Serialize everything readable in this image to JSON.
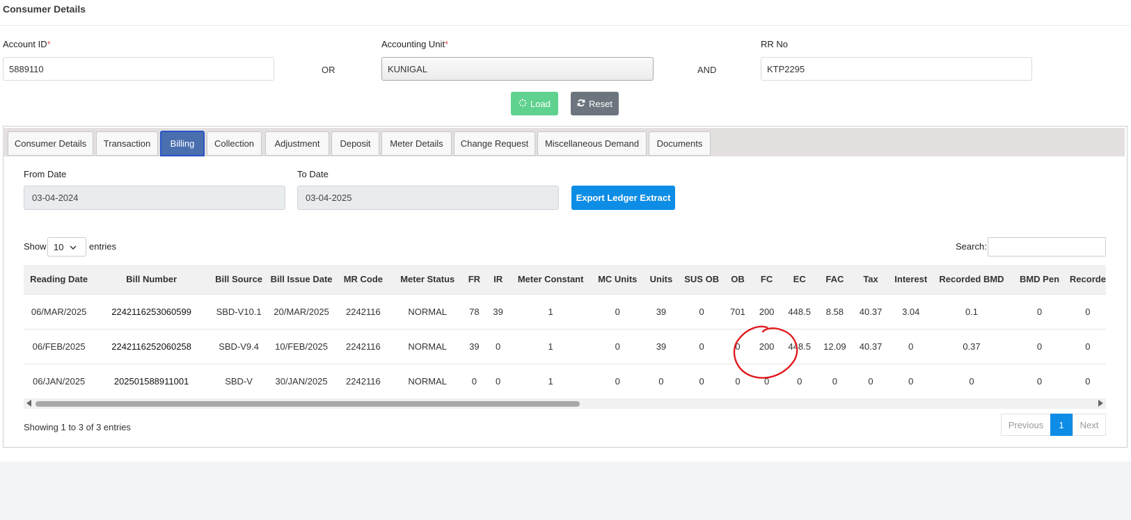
{
  "header": {
    "title": "Consumer Details"
  },
  "search_form": {
    "account_id": {
      "label": "Account ID",
      "required_mark": "*",
      "value": "5889110"
    },
    "or_text": "OR",
    "accounting_unit": {
      "label": "Accounting Unit",
      "required_mark": "*",
      "value": "KUNIGAL"
    },
    "and_text": "AND",
    "rr_no": {
      "label": "RR No",
      "value": "KTP2295"
    },
    "load_label": "Load",
    "reset_label": "Reset"
  },
  "tabs": [
    {
      "label": "Consumer Details",
      "active": false
    },
    {
      "label": "Transaction",
      "active": false
    },
    {
      "label": "Billing",
      "active": true
    },
    {
      "label": "Collection",
      "active": false
    },
    {
      "label": "Adjustment",
      "active": false
    },
    {
      "label": "Deposit",
      "active": false
    },
    {
      "label": "Meter Details",
      "active": false
    },
    {
      "label": "Change Request",
      "active": false
    },
    {
      "label": "Miscellaneous Demand",
      "active": false
    },
    {
      "label": "Documents",
      "active": false
    }
  ],
  "billing": {
    "from_date": {
      "label": "From Date",
      "value": "03-04-2024"
    },
    "to_date": {
      "label": "To Date",
      "value": "03-04-2025"
    },
    "export_label": "Export Ledger Extract",
    "show_label": "Show",
    "entries_value": "10",
    "entries_label": "entries",
    "search_label": "Search:",
    "columns": [
      "Reading Date",
      "Bill Number",
      "Bill Source",
      "Bill Issue Date",
      "MR Code",
      "Meter Status",
      "FR",
      "IR",
      "Meter Constant",
      "MC Units",
      "Units",
      "SUS OB",
      "OB",
      "FC",
      "EC",
      "FAC",
      "Tax",
      "Interest",
      "Recorded BMD",
      "BMD Pen",
      "Recorde"
    ],
    "rows": [
      [
        "06/MAR/2025",
        "2242116253060599",
        "SBD-V10.1",
        "20/MAR/2025",
        "2242116",
        "NORMAL",
        "78",
        "39",
        "1",
        "0",
        "39",
        "0",
        "701",
        "200",
        "448.5",
        "8.58",
        "40.37",
        "3.04",
        "0.1",
        "0",
        "0"
      ],
      [
        "06/FEB/2025",
        "2242116252060258",
        "SBD-V9.4",
        "10/FEB/2025",
        "2242116",
        "NORMAL",
        "39",
        "0",
        "1",
        "0",
        "39",
        "0",
        "0",
        "200",
        "448.5",
        "12.09",
        "40.37",
        "0",
        "0.37",
        "0",
        "0"
      ],
      [
        "06/JAN/2025",
        "202501588911001",
        "SBD-V",
        "30/JAN/2025",
        "2242116",
        "NORMAL",
        "0",
        "0",
        "1",
        "0",
        "0",
        "0",
        "0",
        "0",
        "0",
        "0",
        "0",
        "0",
        "0",
        "0",
        "0"
      ]
    ],
    "info_text": "Showing 1 to 3 of 3 entries",
    "pagination": {
      "previous": "Previous",
      "current": "1",
      "next": "Next"
    }
  },
  "colors": {
    "load_button": "#5fd28f",
    "reset_button": "#6c757d",
    "active_tab": "#4a6fae",
    "export_button": "#0d8de5",
    "annotation": "#e0191d"
  },
  "icons": {
    "load": "spinner-icon",
    "reset": "refresh-icon",
    "dropdown": "chevron-down-icon"
  }
}
